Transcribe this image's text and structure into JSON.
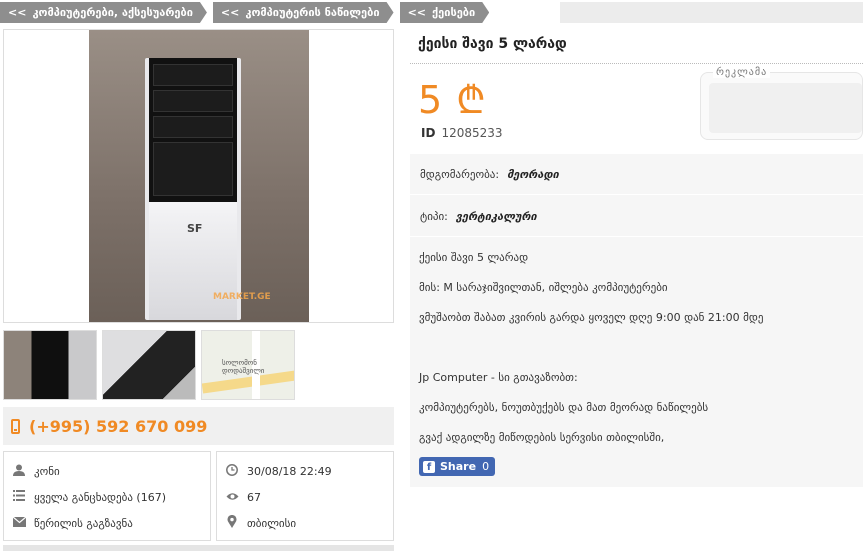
{
  "breadcrumbs": [
    {
      "arrow": "<<",
      "label": "კომპიუტერები, აქსესუარები"
    },
    {
      "arrow": "<<",
      "label": "კომპიუტერის ნაწილები"
    },
    {
      "arrow": "<<",
      "label": "ქეისები"
    }
  ],
  "gallery": {
    "watermark": "MARKET.GE",
    "case_logo": "SF",
    "map_label": "სოლომონ დოდაშვილი"
  },
  "contact": {
    "phone": "(+995) 592 670 099",
    "seller": "კონი",
    "all_ads": "ყველა განცხადება (167)",
    "send_message": "წერილის გაგზავნა",
    "date": "30/08/18 22:49",
    "views": "67",
    "location": "თბილისი"
  },
  "listing": {
    "title": "ქეისი შავი 5 ლარად",
    "price": "5",
    "currency_symbol": "₾",
    "id_label": "ID",
    "id": "12085233",
    "ad_label": "რეკლამა",
    "condition_label": "მდგომარეობა:",
    "condition_value": "მეორადი",
    "type_label": "ტიპი:",
    "type_value": "ვერტიკალური",
    "description": [
      "ქეისი შავი 5 ლარად",
      "მის: M სარაჯიშვილთან, იშლება კომპიუტერები",
      "ვმუშაობთ შაბათ კვირის გარდა ყოველ დღე   9:00 დან 21:00 მდე",
      "",
      "Jp Computer - სი გთავაზობთ:",
      "კომპიუტერებს,   ნოუთბუქებს და მათ მეორად ნაწილებს",
      "გვაქ ადგილზე მიწოდების სერვისი თბილისში,"
    ]
  },
  "share": {
    "label": "Share",
    "count": "0"
  },
  "colors": {
    "accent": "#f08a24",
    "breadcrumb": "#8e8e8e",
    "facebook": "#4267b2"
  }
}
